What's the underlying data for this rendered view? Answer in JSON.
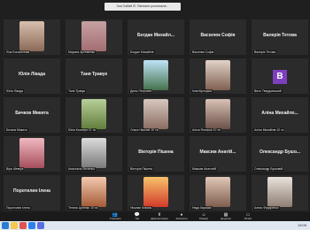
{
  "notice": "Зоя Сабай Й. Паніматі розпочала...",
  "tiles": [
    {
      "id": "t1",
      "label": "Ліза Богомолова",
      "center": ""
    },
    {
      "id": "t2",
      "label": "Марина Артеменко",
      "center": ""
    },
    {
      "id": "t3",
      "label": "Богдан Михайлів",
      "center": "Богдан  Михайл..."
    },
    {
      "id": "t4",
      "label": "Василюк Софія",
      "center": "Василюк Софія"
    },
    {
      "id": "t5",
      "label": "Валерія Тетова",
      "center": "Валерія Тетова"
    },
    {
      "id": "t6",
      "label": "Юлія Лікада",
      "center": "Юлія Лікада"
    },
    {
      "id": "t7",
      "label": "Таня Травук",
      "center": "Таня Травук"
    },
    {
      "id": "t8",
      "label": "Деніс Петрович",
      "center": ""
    },
    {
      "id": "t9",
      "label": "Інна Кірніцька",
      "center": ""
    },
    {
      "id": "t10",
      "label": "Вікто Твердовський",
      "center": "",
      "avatar": "B"
    },
    {
      "id": "t11",
      "label": "Бичков Микита",
      "center": "Бичков Микита"
    },
    {
      "id": "t12",
      "label": "Юлія Кооперя 11 та",
      "center": ""
    },
    {
      "id": "t13",
      "label": "Ольга Ніколяє 10 та",
      "center": ""
    },
    {
      "id": "t14",
      "label": "Аліса Яноська 10 та",
      "center": ""
    },
    {
      "id": "t15",
      "label": "Аліна Михайлів 10 та",
      "center": "Аліна  Михайло..."
    },
    {
      "id": "t16",
      "label": "Віра Шевчук",
      "center": ""
    },
    {
      "id": "t17",
      "label": "Анастасія Зінченко",
      "center": ""
    },
    {
      "id": "t18",
      "label": "Вікторія Пішена",
      "center": "Вікторія Пішена"
    },
    {
      "id": "t19",
      "label": "Максим Анатолій",
      "center": "Максим  Анатій..."
    },
    {
      "id": "t20",
      "label": "Олександр Бушовий",
      "center": "Олександр  Бушо..."
    },
    {
      "id": "t21",
      "label": "Поротилин Ілена",
      "center": "Поротилин Ілена"
    },
    {
      "id": "t22",
      "label": "Тетяна Ціленко 10 та",
      "center": ""
    },
    {
      "id": "t23",
      "label": "Ніколає Коваль",
      "center": ""
    },
    {
      "id": "t24",
      "label": "Неда Карасик",
      "center": ""
    },
    {
      "id": "t25",
      "label": "Алекс Федоренко",
      "center": ""
    }
  ],
  "toolbar": {
    "items": [
      {
        "label": "Учасники",
        "icon": "participants-icon"
      },
      {
        "label": "Чат",
        "icon": "chat-icon"
      },
      {
        "label": "Демонстрація",
        "icon": "share-screen-icon"
      },
      {
        "label": "Записати",
        "icon": "record-icon"
      },
      {
        "label": "Реакції",
        "icon": "reactions-icon"
      },
      {
        "label": "Додатки",
        "icon": "apps-icon"
      },
      {
        "label": "Білий",
        "icon": "whiteboard-icon"
      }
    ]
  },
  "taskbar": {
    "time": "13:09"
  }
}
